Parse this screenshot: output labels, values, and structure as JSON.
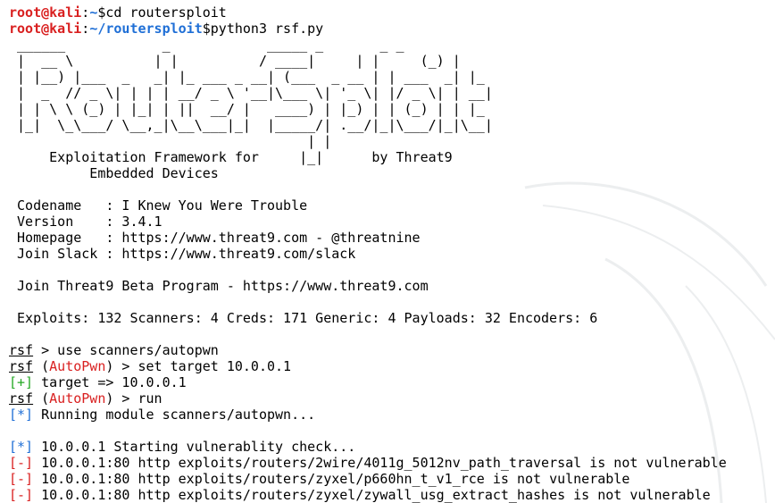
{
  "colors": {
    "background": "#ffffff",
    "text": "#000000",
    "prompt_user": "#d92020",
    "prompt_path": "#1f6fd6",
    "status_info": "#1f6fd6",
    "status_good": "#24a824",
    "status_bad": "#d92020",
    "module": "#d92020"
  },
  "shell": {
    "line1": {
      "user": "root@kali",
      "sep": ":",
      "path": "~",
      "sigil": "$",
      "command": "cd routersploit"
    },
    "line2": {
      "user": "root@kali",
      "sep": ":",
      "path": "~/routersploit",
      "sigil": "$",
      "command": "python3 rsf.py"
    }
  },
  "banner": {
    "ascii_art": " ______            _            _____ _       _ _\n |  __ \\          | |          / ____|     | |     (_) |\n | |__) |___  _   _| |_ ___ _ __| (___  _ __ | | ___  _| |_\n |  _  // _ \\| | | | __/ _ \\ '__|\\___ \\| '_ \\| |/ _ \\| | __|\n | | \\ \\ (_) | |_| | ||  __/ |   ____) | |_) | | (_) | | |_\n |_|  \\_\\___/ \\__,_|\\__\\___|_|  |_____/| .__/|_|\\___/|_|\\__|\n                                     | |\n     Exploitation Framework for     |_|      by Threat9\n          Embedded Devices"
  },
  "info": {
    "codename": " Codename   : I Knew You Were Trouble",
    "version": " Version    : 3.4.1",
    "homepage": " Homepage   : https://www.threat9.com - @threatnine",
    "slack": " Join Slack : https://www.threat9.com/slack",
    "beta": " Join Threat9 Beta Program - https://www.threat9.com",
    "stats": " Exploits: 132 Scanners: 4 Creds: 171 Generic: 4 Payloads: 32 Encoders: 6"
  },
  "session": {
    "prompt": "rsf",
    "module_name": "AutoPwn",
    "cmd1": " > use scanners/autopwn",
    "cmd2_pre": " (",
    "cmd2_post": ") > set target 10.0.0.1",
    "good_tag": "[+]",
    "target_msg": " target => 10.0.0.1",
    "cmd3_pre": " (",
    "cmd3_post": ") > run",
    "info_tag": "[*]",
    "running_msg": " Running module scanners/autopwn...",
    "starting_msg": " 10.0.0.1 Starting vulnerablity check...",
    "bad_tag": "[-]",
    "result1": " 10.0.0.1:80 http exploits/routers/2wire/4011g_5012nv_path_traversal is not vulnerable",
    "result2": " 10.0.0.1:80 http exploits/routers/zyxel/p660hn_t_v1_rce is not vulnerable",
    "result3": " 10.0.0.1:80 http exploits/routers/zyxel/zywall_usg_extract_hashes is not vulnerable"
  }
}
